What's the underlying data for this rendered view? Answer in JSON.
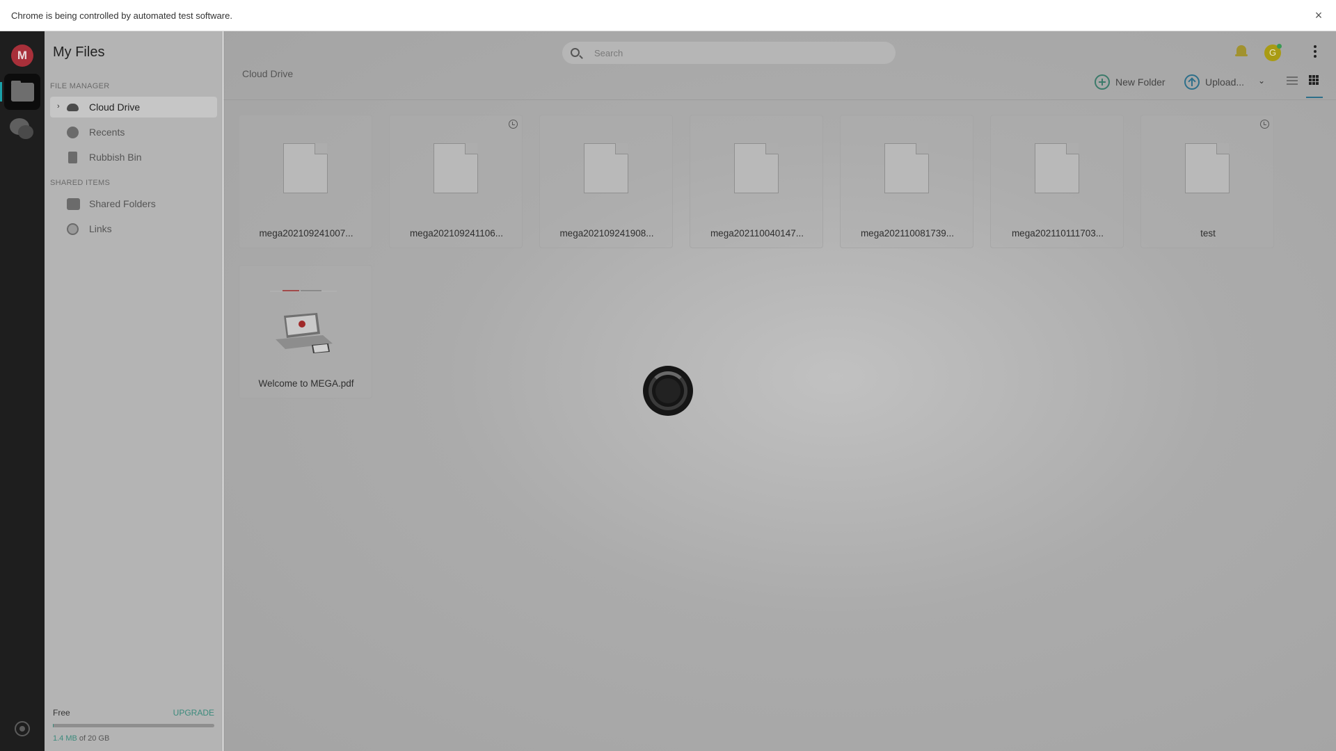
{
  "infobar": {
    "message": "Chrome is being controlled by automated test software.",
    "close_label": "×"
  },
  "brand": {
    "logo_letter": "M"
  },
  "panel": {
    "title": "My Files",
    "file_manager_label": "FILE MANAGER",
    "shared_items_label": "SHARED ITEMS",
    "items": [
      {
        "label": "Cloud Drive",
        "icon": "cloud-icon"
      },
      {
        "label": "Recents",
        "icon": "clock-icon"
      },
      {
        "label": "Rubbish Bin",
        "icon": "trash-icon"
      },
      {
        "label": "Shared Folders",
        "icon": "shared-folder-icon"
      },
      {
        "label": "Links",
        "icon": "link-icon"
      }
    ],
    "plan": {
      "name": "Free",
      "upgrade": "UPGRADE",
      "used": "1.4 MB",
      "of_total": " of 20 GB",
      "usage_fraction": 7e-05
    }
  },
  "search": {
    "placeholder": "Search"
  },
  "account": {
    "avatar_letter": "G",
    "online_color": "#3a9a53"
  },
  "toolbar": {
    "breadcrumb": "Cloud Drive",
    "new_folder": "New Folder",
    "upload": "Upload...",
    "upload_menu_icon": "chevron-down-icon"
  },
  "files": [
    {
      "name": "mega202109241007...",
      "has_versions": false
    },
    {
      "name": "mega202109241106...",
      "has_versions": true
    },
    {
      "name": "mega202109241908...",
      "has_versions": false
    },
    {
      "name": "mega202110040147...",
      "has_versions": false
    },
    {
      "name": "mega202110081739...",
      "has_versions": false
    },
    {
      "name": "mega202110111703...",
      "has_versions": false
    },
    {
      "name": "test",
      "has_versions": true
    },
    {
      "name": "Welcome to MEGA.pdf",
      "has_versions": false,
      "thumbnail": true
    }
  ],
  "colors": {
    "accent": "#3b8a7c",
    "brand_red": "#a8303a",
    "upload_blue": "#2d6f8a"
  }
}
